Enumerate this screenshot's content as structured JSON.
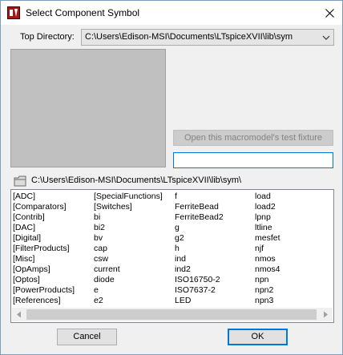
{
  "window": {
    "title": "Select Component Symbol",
    "icon": "ltspice-app-icon",
    "close_glyph": "✕"
  },
  "top_directory": {
    "label": "Top Directory:",
    "value": "C:\\Users\\Edison-MSI\\Documents\\LTspiceXVII\\lib\\sym"
  },
  "fixture_button": {
    "label": "Open this macromodel's test fixture",
    "enabled": false
  },
  "search": {
    "value": "",
    "placeholder": ""
  },
  "current_path": "C:\\Users\\Edison-MSI\\Documents\\LTspiceXVII\\lib\\sym\\",
  "symbol_list": {
    "columns": [
      [
        "[ADC]",
        "[Comparators]",
        "[Contrib]",
        "[DAC]",
        "[Digital]",
        "[FilterProducts]",
        "[Misc]",
        "[OpAmps]",
        "[Optos]",
        "[PowerProducts]",
        "[References]"
      ],
      [
        "[SpecialFunctions]",
        "[Switches]",
        "bi",
        "bi2",
        "bv",
        "cap",
        "csw",
        "current",
        "diode",
        "e",
        "e2"
      ],
      [
        "f",
        "FerriteBead",
        "FerriteBead2",
        "g",
        "g2",
        "h",
        "ind",
        "ind2",
        "ISO16750-2",
        "ISO7637-2",
        "LED"
      ],
      [
        "load",
        "load2",
        "lpnp",
        "ltline",
        "mesfet",
        "njf",
        "nmos",
        "nmos4",
        "npn",
        "npn2",
        "npn3"
      ]
    ]
  },
  "buttons": {
    "cancel": "Cancel",
    "ok": "OK"
  },
  "colors": {
    "accent": "#0078d7",
    "preview_bg": "#c0c0c0",
    "app_icon": "#a01818"
  }
}
